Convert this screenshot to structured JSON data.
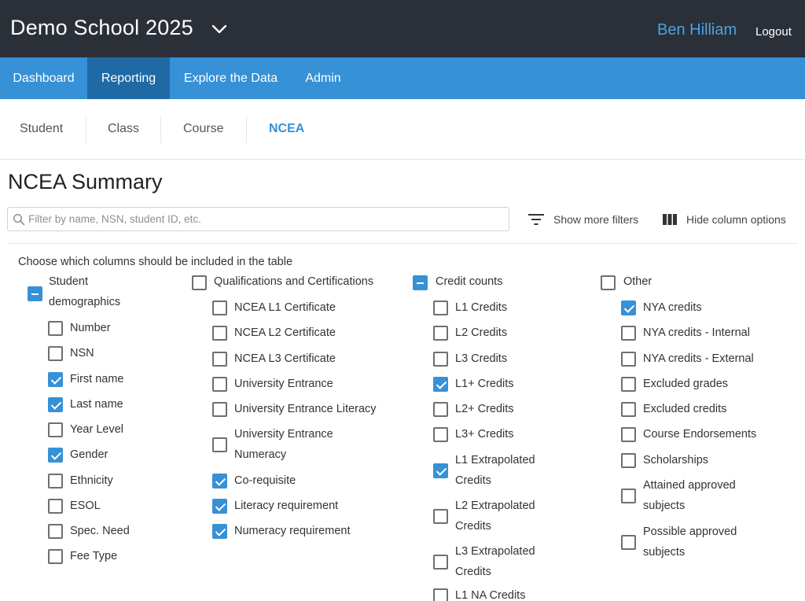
{
  "header": {
    "school_name": "Demo School 2025",
    "user_name": "Ben Hilliam",
    "logout_label": "Logout"
  },
  "nav": {
    "items": [
      "Dashboard",
      "Reporting",
      "Explore the Data",
      "Admin"
    ],
    "active": "Reporting"
  },
  "subtabs": {
    "items": [
      "Student",
      "Class",
      "Course",
      "NCEA"
    ],
    "active": "NCEA"
  },
  "page": {
    "title": "NCEA Summary"
  },
  "search": {
    "placeholder": "Filter by name, NSN, student ID, etc.",
    "value": ""
  },
  "tools": {
    "more_filters_label": "Show more filters",
    "column_options_label": "Hide column options"
  },
  "columns_panel": {
    "instruction": "Choose which columns should be included in the table",
    "groups": [
      {
        "label_lines": [
          "Student",
          "demographics"
        ],
        "state": "partial",
        "options": [
          {
            "label": "Number",
            "checked": false
          },
          {
            "label": "NSN",
            "checked": false
          },
          {
            "label": "First name",
            "checked": true
          },
          {
            "label": "Last name",
            "checked": true
          },
          {
            "label": "Year Level",
            "checked": false
          },
          {
            "label": "Gender",
            "checked": true
          },
          {
            "label": "Ethnicity",
            "checked": false
          },
          {
            "label": "ESOL",
            "checked": false
          },
          {
            "label": "Spec. Need",
            "checked": false
          },
          {
            "label": "Fee Type",
            "checked": false
          }
        ]
      },
      {
        "label_lines": [
          "Qualifications and Certifications"
        ],
        "state": "unchecked",
        "options": [
          {
            "label": "NCEA L1 Certificate",
            "checked": false
          },
          {
            "label": "NCEA L2 Certificate",
            "checked": false
          },
          {
            "label": "NCEA L3 Certificate",
            "checked": false
          },
          {
            "label": "University Entrance",
            "checked": false
          },
          {
            "label": "University Entrance Literacy",
            "checked": false
          },
          {
            "label_lines": [
              "University Entrance",
              "Numeracy"
            ],
            "checked": false
          },
          {
            "label": "Co-requisite",
            "checked": true
          },
          {
            "label": "Literacy requirement",
            "checked": true
          },
          {
            "label": "Numeracy requirement",
            "checked": true
          }
        ]
      },
      {
        "label_lines": [
          "Credit counts"
        ],
        "state": "partial",
        "options": [
          {
            "label": "L1 Credits",
            "checked": false
          },
          {
            "label": "L2 Credits",
            "checked": false
          },
          {
            "label": "L3 Credits",
            "checked": false
          },
          {
            "label": "L1+ Credits",
            "checked": true
          },
          {
            "label": "L2+ Credits",
            "checked": false
          },
          {
            "label": "L3+ Credits",
            "checked": false
          },
          {
            "label_lines": [
              "L1 Extrapolated",
              "Credits"
            ],
            "checked": true
          },
          {
            "label_lines": [
              "L2 Extrapolated",
              "Credits"
            ],
            "checked": false
          },
          {
            "label_lines": [
              "L3 Extrapolated",
              "Credits"
            ],
            "checked": false
          },
          {
            "label": "L1 NA Credits",
            "checked": false
          }
        ]
      },
      {
        "label_lines": [
          "Other"
        ],
        "state": "unchecked",
        "options": [
          {
            "label": "NYA credits",
            "checked": true
          },
          {
            "label": "NYA credits - Internal",
            "checked": false
          },
          {
            "label": "NYA credits - External",
            "checked": false
          },
          {
            "label": "Excluded grades",
            "checked": false
          },
          {
            "label": "Excluded credits",
            "checked": false
          },
          {
            "label": "Course Endorsements",
            "checked": false
          },
          {
            "label": "Scholarships",
            "checked": false
          },
          {
            "label_lines": [
              "Attained approved",
              "subjects"
            ],
            "checked": false
          },
          {
            "label_lines": [
              "Possible approved",
              "subjects"
            ],
            "checked": false
          }
        ]
      }
    ]
  },
  "colors": {
    "header_bg": "#2b3038",
    "nav_bg": "#3691d6",
    "nav_active_bg": "#1f6aa5",
    "accent": "#3691d6",
    "user_name": "#4aa3e3"
  }
}
